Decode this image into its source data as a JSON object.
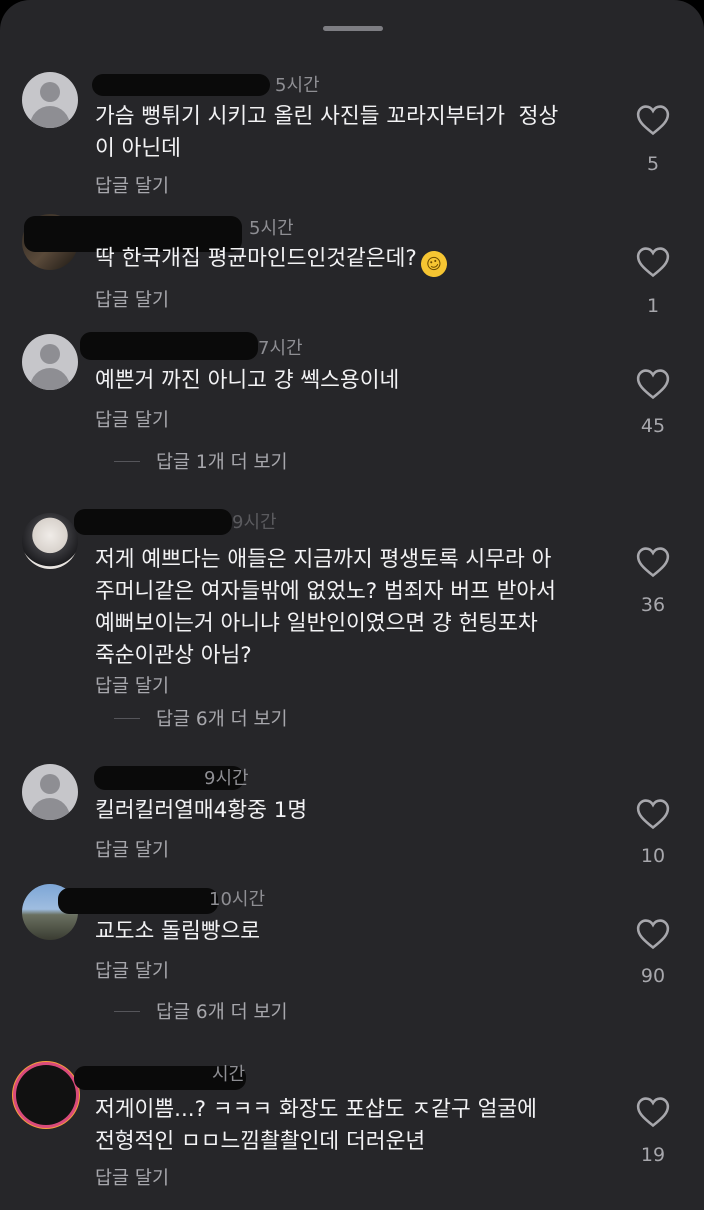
{
  "ui": {
    "reply_label": "답글 달기"
  },
  "comments": [
    {
      "time": "5시간",
      "text": "가슴 뻥튀기 시키고 올린 사진들 꼬라지부터가  정상\n이 아닌데",
      "likes": "5"
    },
    {
      "time": "5시간",
      "text": "딱 한국개집 평균마인드인것같은데?",
      "emoji": "🤣",
      "likes": "1"
    },
    {
      "time": "7시간",
      "text": "예쁜거 까진 아니고 걍 쎅스용이네",
      "likes": "45",
      "more_replies": "답글 1개 더 보기"
    },
    {
      "time": "9시간",
      "text": "저게 예쁘다는 애들은 지금까지 평생토록 시무라 아\n주머니같은 여자들밖에 없었노? 범죄자 버프 받아서\n예뻐보이는거 아니냐 일반인이였으면 걍 헌팅포차\n죽순이관상 아님?",
      "likes": "36",
      "more_replies": "답글 6개 더 보기"
    },
    {
      "time": "9시간",
      "text": "킬러킬러열매4황중 1명",
      "likes": "10"
    },
    {
      "time": "10시간",
      "text": "교도소 돌림빵으로",
      "likes": "90",
      "more_replies": "답글 6개 더 보기"
    },
    {
      "time": "시간",
      "text": "저게이쁨...? ㅋㅋㅋ 화장도 포샵도 ㅈ같구 얼굴에\n전형적인 ㅁㅁ느낌촬촬인데 더러운년",
      "likes": "19"
    }
  ]
}
